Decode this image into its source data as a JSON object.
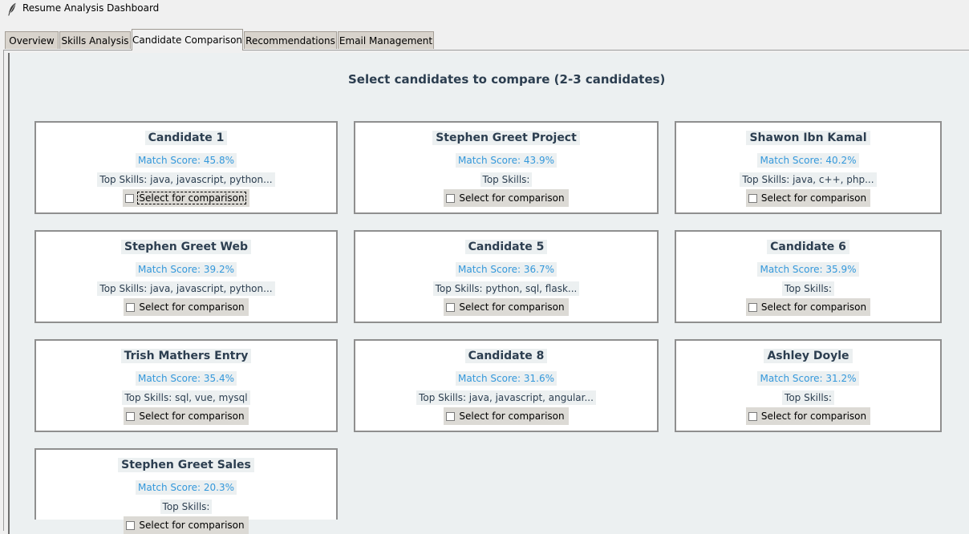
{
  "window": {
    "title": "Resume Analysis Dashboard",
    "icon": "feather-icon"
  },
  "tabs": [
    {
      "label": "Overview",
      "active": false
    },
    {
      "label": "Skills Analysis",
      "active": false
    },
    {
      "label": "Candidate Comparison",
      "active": true
    },
    {
      "label": "Recommendations",
      "active": false
    },
    {
      "label": "Email Management",
      "active": false
    }
  ],
  "main": {
    "heading": "Select candidates to compare (2-3 candidates)"
  },
  "colors": {
    "heading_text": "#2c3e50",
    "score_text": "#3498db",
    "panel_bg": "#ecf0f1",
    "card_bg": "#ffffff"
  },
  "candidates": [
    {
      "name": "Candidate 1",
      "score": "Match Score: 45.8%",
      "skills": "Top Skills: java, javascript, python...",
      "select_label": "Select for comparison",
      "checked": false
    },
    {
      "name": "Stephen Greet Project",
      "score": "Match Score: 43.9%",
      "skills": "Top Skills: ",
      "select_label": "Select for comparison",
      "checked": false
    },
    {
      "name": "Shawon Ibn Kamal",
      "score": "Match Score: 40.2%",
      "skills": "Top Skills: java, c++, php...",
      "select_label": "Select for comparison",
      "checked": false
    },
    {
      "name": "Stephen Greet Web",
      "score": "Match Score: 39.2%",
      "skills": "Top Skills: java, javascript, python...",
      "select_label": "Select for comparison",
      "checked": false
    },
    {
      "name": "Candidate 5",
      "score": "Match Score: 36.7%",
      "skills": "Top Skills: python, sql, flask...",
      "select_label": "Select for comparison",
      "checked": false
    },
    {
      "name": "Candidate 6",
      "score": "Match Score: 35.9%",
      "skills": "Top Skills: ",
      "select_label": "Select for comparison",
      "checked": false
    },
    {
      "name": "Trish Mathers Entry",
      "score": "Match Score: 35.4%",
      "skills": "Top Skills: sql, vue, mysql",
      "select_label": "Select for comparison",
      "checked": false
    },
    {
      "name": "Candidate 8",
      "score": "Match Score: 31.6%",
      "skills": "Top Skills: java, javascript, angular...",
      "select_label": "Select for comparison",
      "checked": false
    },
    {
      "name": "Ashley Doyle",
      "score": "Match Score: 31.2%",
      "skills": "Top Skills: ",
      "select_label": "Select for comparison",
      "checked": false
    },
    {
      "name": "Stephen Greet Sales",
      "score": "Match Score: 20.3%",
      "skills": "Top Skills: ",
      "select_label": "Select for comparison",
      "checked": false
    }
  ]
}
